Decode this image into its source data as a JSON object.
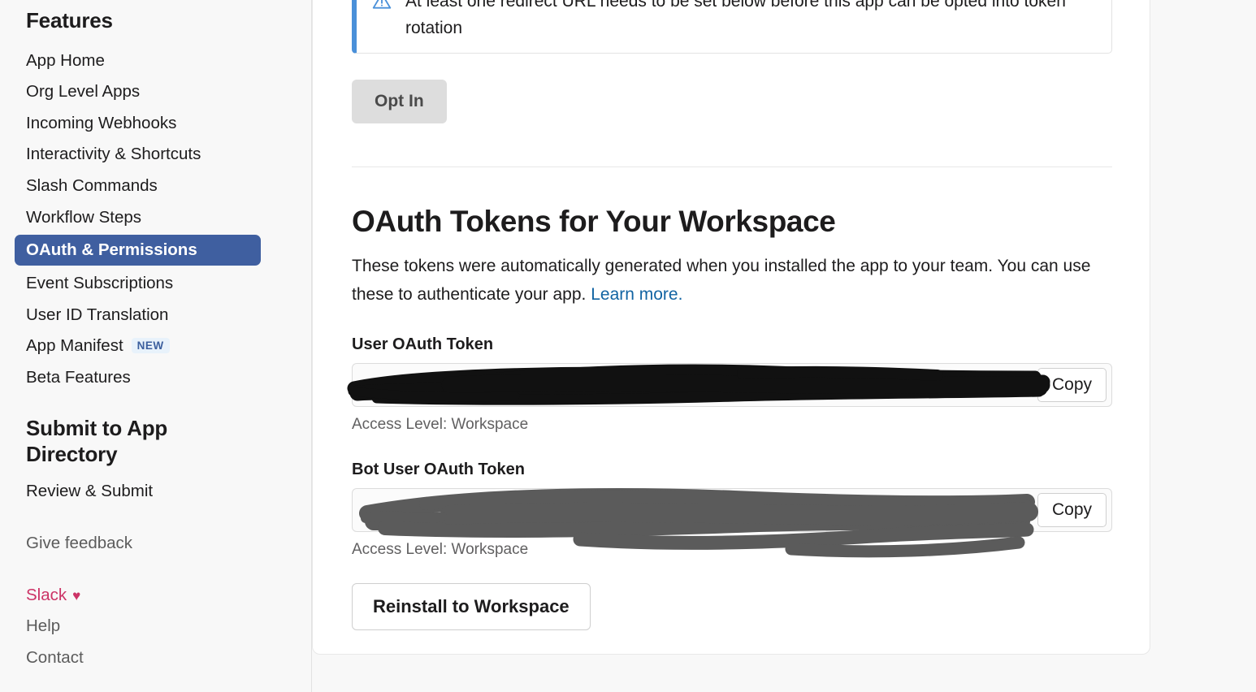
{
  "sidebar": {
    "features_heading": "Features",
    "items": [
      {
        "label": "App Home",
        "active": false
      },
      {
        "label": "Org Level Apps",
        "active": false
      },
      {
        "label": "Incoming Webhooks",
        "active": false
      },
      {
        "label": "Interactivity & Shortcuts",
        "active": false
      },
      {
        "label": "Slash Commands",
        "active": false
      },
      {
        "label": "Workflow Steps",
        "active": false
      },
      {
        "label": "OAuth & Permissions",
        "active": true
      },
      {
        "label": "Event Subscriptions",
        "active": false
      },
      {
        "label": "User ID Translation",
        "active": false
      },
      {
        "label": "App Manifest",
        "active": false,
        "badge": "NEW"
      },
      {
        "label": "Beta Features",
        "active": false
      }
    ],
    "submit_heading": "Submit to App Directory",
    "submit_items": [
      {
        "label": "Review & Submit"
      }
    ],
    "footer": {
      "feedback": "Give feedback",
      "slack": "Slack",
      "heart_icon": "heart-icon",
      "help": "Help",
      "contact": "Contact"
    }
  },
  "main": {
    "alert": {
      "icon": "warning-triangle-icon",
      "text": "At least one redirect URL needs to be set below before this app can be opted into token rotation",
      "accent_color": "#4a90d9"
    },
    "opt_in_label": "Opt In",
    "section": {
      "title": "OAuth Tokens for Your Workspace",
      "description_part1": "These tokens were automatically generated when you installed the app to your team. You can use these to authenticate your app. ",
      "learn_more": "Learn more."
    },
    "tokens": [
      {
        "label": "User OAuth Token",
        "value": "",
        "redaction": "black-marker-scribble",
        "copy_label": "Copy",
        "access_note": "Access Level: Workspace"
      },
      {
        "label": "Bot User OAuth Token",
        "value": "",
        "redaction": "gray-marker-scribble",
        "copy_label": "Copy",
        "access_note": "Access Level: Workspace"
      }
    ],
    "reinstall_label": "Reinstall to Workspace"
  },
  "colors": {
    "active_nav": "#3f5fa0",
    "link": "#1264a3",
    "slack_pink": "#cc3366",
    "badge_bg": "#e8f2fb",
    "badge_text": "#3b5f9e",
    "page_bg": "#f8f8f8"
  }
}
